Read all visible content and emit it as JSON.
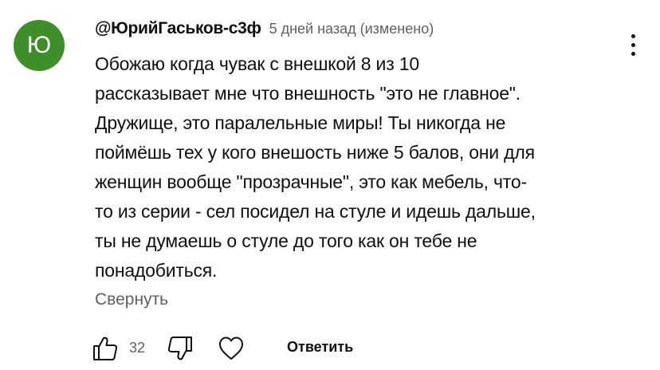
{
  "comment": {
    "avatar_letter": "Ю",
    "avatar_color": "#3e8e2a",
    "author": "@ЮрийГаськов-с3ф",
    "meta": "5 дней назад (изменено)",
    "lines": [
      "Обожаю когда чувак с внешкой 8 из 10",
      "рассказывает мне что внешность \"это не главное\".",
      "Дружище, это паралельные миры! Ты никогда не",
      "поймёшь тех у кого внешость ниже 5 балов, они для",
      "женщин вообще \"прозрачные\", это как мебель, что-",
      "то из серии - сел посидел на стуле и идешь дальше,",
      "ты не думаешь о стуле до того как он тебе не",
      "понадобиться."
    ],
    "collapse_label": "Свернуть",
    "like_count": "32",
    "reply_label": "Ответить"
  },
  "icons": {
    "more": "vertical-dots-icon",
    "like": "thumb-up-icon",
    "dislike": "thumb-down-icon",
    "heart": "heart-icon"
  }
}
